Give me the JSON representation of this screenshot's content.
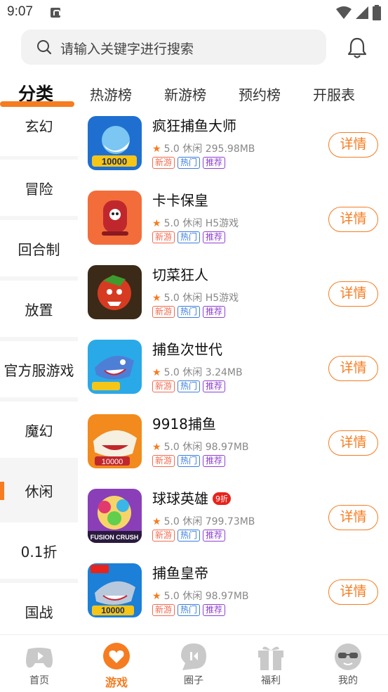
{
  "status_bar": {
    "time": "9:07"
  },
  "search": {
    "placeholder": "请输入关键字进行搜索"
  },
  "top_tabs": [
    "分类",
    "热游榜",
    "新游榜",
    "预约榜",
    "开服表"
  ],
  "categories": [
    "玄幻",
    "冒险",
    "回合制",
    "放置",
    "官方服游戏",
    "魔幻",
    "休闲",
    "0.1折",
    "国战"
  ],
  "active_category": "休闲",
  "games": [
    {
      "name": "疯狂捕鱼大师",
      "rating": "5.0",
      "genre": "休闲",
      "size": "295.98MB",
      "tags": [
        "新游",
        "热门",
        "推荐"
      ],
      "detail": "详情"
    },
    {
      "name": "卡卡保皇",
      "rating": "5.0",
      "genre": "休闲",
      "size": "H5游戏",
      "tags": [
        "新游",
        "热门",
        "推荐"
      ],
      "detail": "详情"
    },
    {
      "name": "切菜狂人",
      "rating": "5.0",
      "genre": "休闲",
      "size": "H5游戏",
      "tags": [
        "新游",
        "热门",
        "推荐"
      ],
      "detail": "详情"
    },
    {
      "name": "捕鱼次世代",
      "rating": "5.0",
      "genre": "休闲",
      "size": "3.24MB",
      "tags": [
        "新游",
        "热门",
        "推荐"
      ],
      "detail": "详情"
    },
    {
      "name": "9918捕鱼",
      "rating": "5.0",
      "genre": "休闲",
      "size": "98.97MB",
      "tags": [
        "新游",
        "热门",
        "推荐"
      ],
      "detail": "详情"
    },
    {
      "name": "球球英雄",
      "discount": "9折",
      "rating": "5.0",
      "genre": "休闲",
      "size": "799.73MB",
      "tags": [
        "新游",
        "热门",
        "推荐"
      ],
      "detail": "详情"
    },
    {
      "name": "捕鱼皇帝",
      "rating": "5.0",
      "genre": "休闲",
      "size": "98.97MB",
      "tags": [
        "新游",
        "热门",
        "推荐"
      ],
      "detail": "详情"
    }
  ],
  "bottom_nav": [
    "首页",
    "游戏",
    "圈子",
    "福利",
    "我的"
  ],
  "colors": {
    "accent": "#f57c20",
    "tag_new": "#f26b50",
    "tag_hot": "#3a7de0",
    "tag_rec": "#8e3fd1"
  }
}
